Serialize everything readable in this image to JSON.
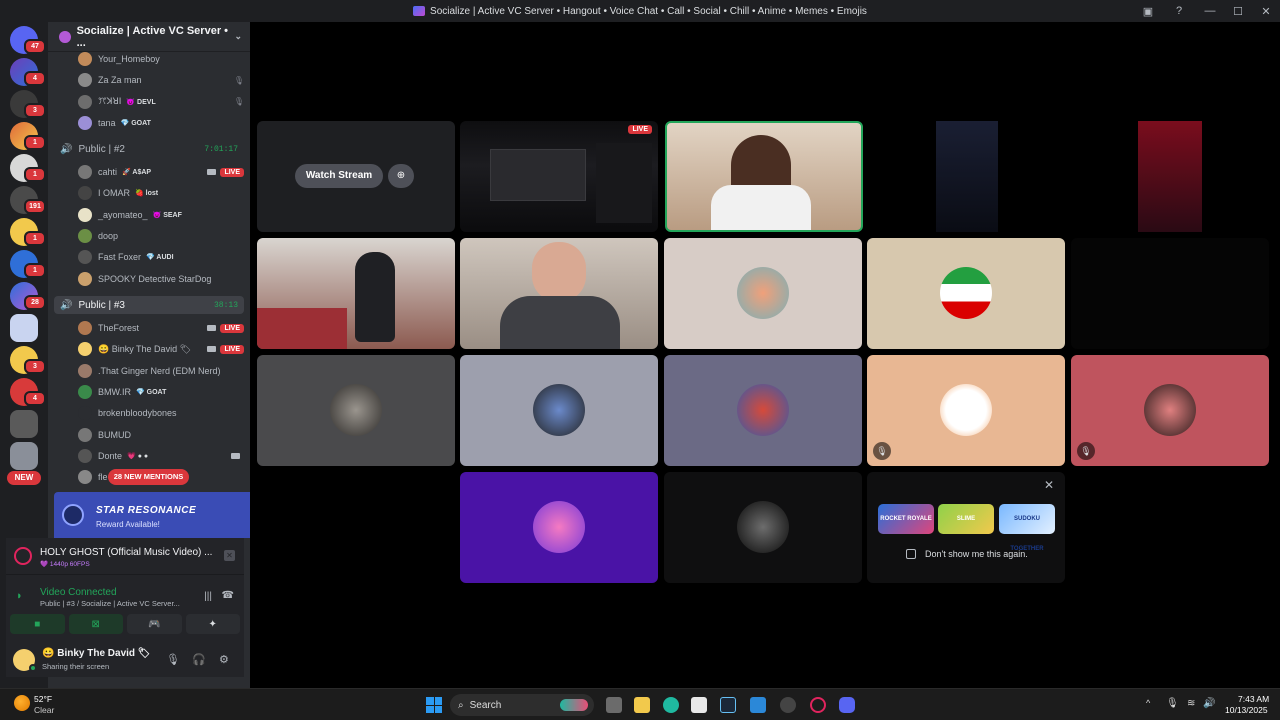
{
  "window": {
    "title": "Socialize | Active VC Server • Hangout • Voice Chat • Call • Social • Chill • Anime • Memes • Emojis",
    "minimize": "—",
    "maximize": "☐",
    "close": "✕",
    "inbox_icon": "inbox-icon",
    "help_icon": "help-icon",
    "help_glyph": "?"
  },
  "server_rail": {
    "badges": [
      "47",
      "4",
      "3",
      "1",
      "1",
      "191",
      "1",
      "1",
      "28",
      "3",
      "4"
    ],
    "new_label": "NEW"
  },
  "sidebar": {
    "server_name": "Socialize | Active VC Server • ...",
    "chevron": "⌄",
    "top_users": [
      {
        "name": "Your_Homeboy",
        "tag": "",
        "color": "#c28b5a"
      },
      {
        "name": "Za Za man",
        "tag": "",
        "color": "#8a8a8a",
        "mute": "🎙"
      },
      {
        "name": "ꔫꓘꓤꓲ",
        "tag": "😈 DEVL",
        "color": "#6d6d6d",
        "mute": "🎙"
      },
      {
        "name": "tana",
        "tag": "💎 GOAT",
        "color": "#9b8fd6"
      }
    ],
    "channel_2": {
      "name": "Public | #2",
      "timer": "7:01:17",
      "icon": "speaker-icon"
    },
    "channel_2_users": [
      {
        "name": "cahti",
        "tag": "🚀 A$AP",
        "color": "#777",
        "cam": true,
        "live": "LIVE"
      },
      {
        "name": "I OMAR",
        "tag": "🍓 lost",
        "color": "#444"
      },
      {
        "name": "_ayomateo_",
        "tag": "😈 SEAF",
        "color": "#e8e2c8"
      },
      {
        "name": "doop",
        "tag": "",
        "color": "#6b8f45"
      },
      {
        "name": "Fast Foxer",
        "tag": "💎 AUDI",
        "color": "#555"
      },
      {
        "name": "SPOOKY Detective StarDog",
        "tag": "",
        "color": "#caa06c"
      }
    ],
    "channel_3": {
      "name": "Public | #3",
      "timer": "38:13",
      "icon": "speaker-icon"
    },
    "channel_3_users": [
      {
        "name": "TheForest",
        "tag": "",
        "color": "#b07850",
        "cam": true,
        "live": "LIVE"
      },
      {
        "name": "😀 Binky The David 🏷",
        "tag": "",
        "color": "#f5d06e",
        "cam": true,
        "live": "LIVE"
      },
      {
        "name": ".That Ginger Nerd (EDM Nerd)",
        "tag": "",
        "color": "#9a7a6a"
      },
      {
        "name": "BMW.IR",
        "tag": "💎 GOAT",
        "color": "#3a8a4a"
      },
      {
        "name": "brokenbloodybones",
        "tag": "",
        "color": "#2b2d31"
      },
      {
        "name": "BUMUD",
        "tag": "",
        "color": "#777"
      },
      {
        "name": "Donte",
        "tag": "💗 ● ●",
        "color": "#555",
        "cam": true
      },
      {
        "name": "fle",
        "tag": "",
        "color": "#888"
      }
    ],
    "mentions_label": "28 NEW MENTIONS"
  },
  "promo": {
    "title": "STAR RESONANCE",
    "subtitle": "Reward Available!"
  },
  "now_playing": {
    "title": "HOLY GHOST (Official Music Video) ...",
    "quality": "💜 1440p 60FPS",
    "close": "✕"
  },
  "voice": {
    "status": "Video Connected",
    "location": "Public | #3 / Socialize | Active VC Server...",
    "wave": "|||",
    "hangup": "☎"
  },
  "actions": {
    "camera": "■",
    "screen": "⊠",
    "activity": "🎮",
    "soundboard": "✦"
  },
  "user": {
    "name": "😀 Binky The David 🏷",
    "status": "Sharing their screen",
    "mic": "🎙",
    "headphones": "🎧",
    "settings": "⚙"
  },
  "stage": {
    "watch_label": "Watch Stream",
    "watch_icon": "⊕",
    "live_label": "LIVE",
    "mute_glyph": "🎙",
    "close": "✕",
    "games": [
      "ROCKET ROYALE",
      "SLIME",
      "SUDOKU TOGETHER"
    ],
    "dont_show": "Don't show me this again."
  },
  "taskbar": {
    "temp": "52°F",
    "cond": "Clear",
    "search": "Search",
    "search_glyph": "⌕",
    "tray_up": "^",
    "mic": "🎙",
    "wifi": "≋",
    "volume": "🔊",
    "time": "7:43 AM",
    "date": "10/13/2025"
  }
}
